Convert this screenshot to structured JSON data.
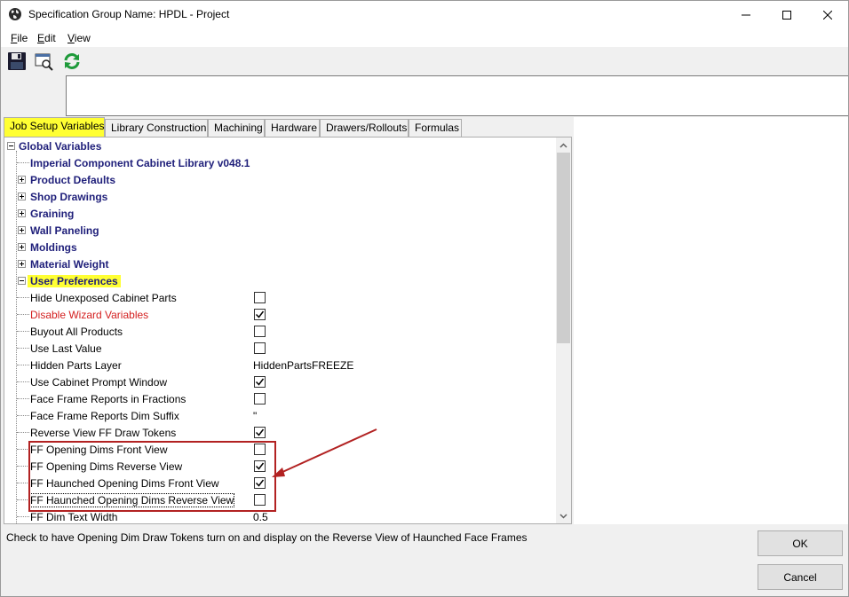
{
  "window": {
    "title": "Specification Group Name: HPDL - Project",
    "icon": "globe-icon"
  },
  "menu": [
    {
      "label": "File",
      "accel": "F",
      "rest": "ile"
    },
    {
      "label": "Edit",
      "accel": "E",
      "rest": "dit"
    },
    {
      "label": "View",
      "accel": "V",
      "rest": "iew"
    }
  ],
  "toolbar": {
    "save_icon": "floppy-disk-icon",
    "preview_icon": "print-preview-icon",
    "refresh_icon": "refresh-icon"
  },
  "tabs": [
    {
      "label": "Job Setup Variables",
      "active": true
    },
    {
      "label": "Library Construction"
    },
    {
      "label": "Machining"
    },
    {
      "label": "Hardware"
    },
    {
      "label": "Drawers/Rollouts"
    },
    {
      "label": "Formulas"
    }
  ],
  "tree": {
    "root": "Global Variables",
    "groups": [
      {
        "label": "Imperial Component Cabinet Library v048.1"
      },
      {
        "label": "Product Defaults"
      },
      {
        "label": "Shop Drawings"
      },
      {
        "label": "Graining"
      },
      {
        "label": "Wall Paneling"
      },
      {
        "label": "Moldings"
      },
      {
        "label": "Material Weight"
      },
      {
        "label": "User Preferences"
      }
    ],
    "items": [
      {
        "label": "Hide Unexposed Cabinet Parts",
        "checked": false
      },
      {
        "label": "Disable Wizard Variables",
        "checked": true
      },
      {
        "label": "Buyout All Products",
        "checked": false
      },
      {
        "label": "Use Last Value",
        "checked": false
      },
      {
        "label": "Hidden Parts Layer",
        "value": "HiddenPartsFREEZE"
      },
      {
        "label": "Use Cabinet Prompt Window",
        "checked": true
      },
      {
        "label": "Face Frame Reports in Fractions",
        "checked": false
      },
      {
        "label": "Face Frame Reports Dim Suffix",
        "value": "\""
      },
      {
        "label": "Reverse View FF Draw Tokens",
        "checked": true
      },
      {
        "label": "FF Opening Dims Front View",
        "checked": false
      },
      {
        "label": "FF Opening Dims Reverse View",
        "checked": true
      },
      {
        "label": "FF Haunched Opening Dims Front View",
        "checked": true
      },
      {
        "label": "FF Haunched Opening Dims Reverse View",
        "checked": false
      },
      {
        "label": "FF Dim Text Width",
        "value": "0.5"
      }
    ]
  },
  "description": "Check to have Opening Dim Draw Tokens turn on and display on the Reverse View of Haunched Face Frames",
  "buttons": {
    "ok": "OK",
    "cancel": "Cancel"
  },
  "colors": {
    "highlight": "#ffff33",
    "annotation": "#b22222",
    "group_text": "#1f1f7a",
    "warning_text": "#d42020"
  }
}
